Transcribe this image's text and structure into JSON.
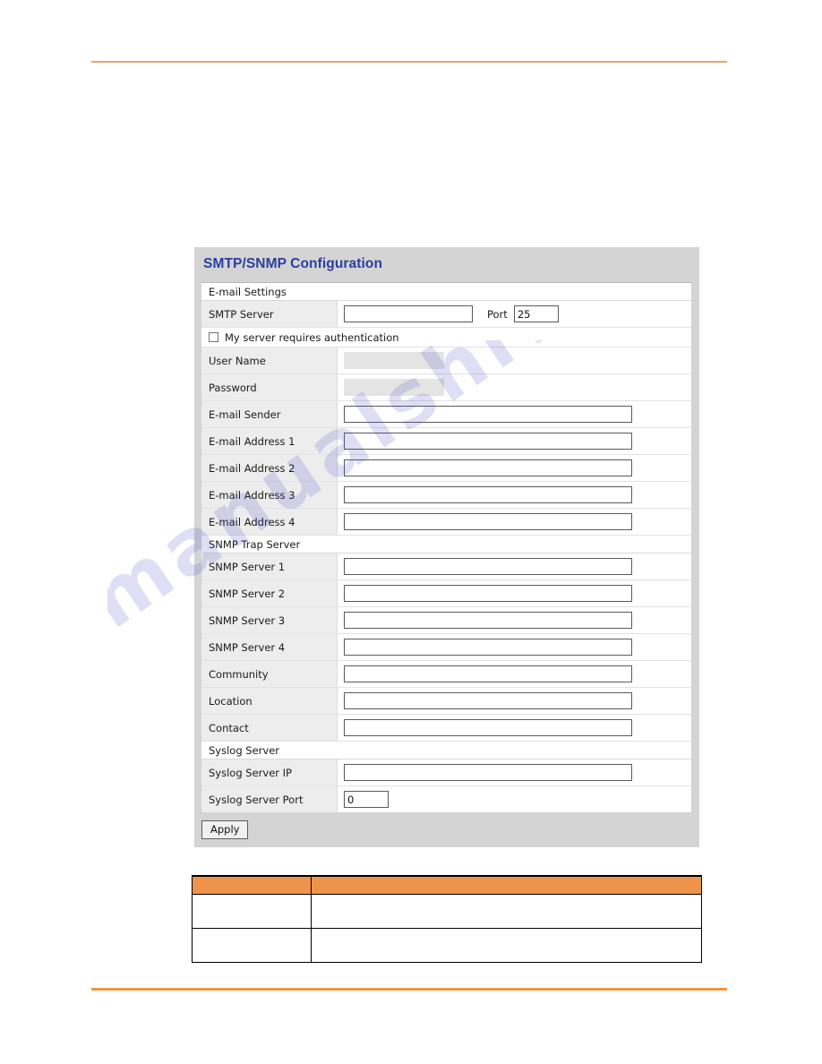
{
  "page": {
    "rule_color_top": "#e0a96d",
    "rule_color_bottom": "#ee9544",
    "watermark_text": "manualshive.com"
  },
  "panel": {
    "title": "SMTP/SNMP Configuration",
    "title_color": "#2c3e9e",
    "sections": [
      {
        "header": "E-mail Settings",
        "rows": [
          {
            "type": "field",
            "label": "SMTP Server",
            "value": "",
            "input_size": "medium",
            "extra_label": "Port",
            "extra_value": "25",
            "extra_size": "small"
          },
          {
            "type": "checkbox",
            "label": "My server requires authentication",
            "checked": false
          },
          {
            "type": "field",
            "label": "User Name",
            "value": "",
            "input_size": "disabled",
            "disabled": true
          },
          {
            "type": "field",
            "label": "Password",
            "value": "",
            "input_size": "disabled",
            "disabled": true
          },
          {
            "type": "field",
            "label": "E-mail Sender",
            "value": "",
            "input_size": "wide"
          },
          {
            "type": "field",
            "label": "E-mail Address 1",
            "value": "",
            "input_size": "wide"
          },
          {
            "type": "field",
            "label": "E-mail Address 2",
            "value": "",
            "input_size": "wide"
          },
          {
            "type": "field",
            "label": "E-mail Address 3",
            "value": "",
            "input_size": "wide"
          },
          {
            "type": "field",
            "label": "E-mail Address 4",
            "value": "",
            "input_size": "wide"
          }
        ]
      },
      {
        "header": "SNMP Trap Server",
        "rows": [
          {
            "type": "field",
            "label": "SNMP Server 1",
            "value": "",
            "input_size": "wide"
          },
          {
            "type": "field",
            "label": "SNMP Server 2",
            "value": "",
            "input_size": "wide"
          },
          {
            "type": "field",
            "label": "SNMP Server 3",
            "value": "",
            "input_size": "wide"
          },
          {
            "type": "field",
            "label": "SNMP Server 4",
            "value": "",
            "input_size": "wide"
          },
          {
            "type": "field",
            "label": "Community",
            "value": "",
            "input_size": "wide"
          },
          {
            "type": "field",
            "label": "Location",
            "value": "",
            "input_size": "wide"
          },
          {
            "type": "field",
            "label": "Contact",
            "value": "",
            "input_size": "wide"
          }
        ]
      },
      {
        "header": "Syslog Server",
        "rows": [
          {
            "type": "field",
            "label": "Syslog Server IP",
            "value": "",
            "input_size": "wide"
          },
          {
            "type": "field",
            "label": "Syslog Server Port",
            "value": "0",
            "input_size": "small"
          }
        ]
      }
    ],
    "apply_label": "Apply"
  },
  "bottom_table": {
    "header_color": "#f0934a",
    "headers": [
      "",
      ""
    ],
    "rows": [
      [
        "",
        ""
      ],
      [
        "",
        ""
      ]
    ]
  }
}
